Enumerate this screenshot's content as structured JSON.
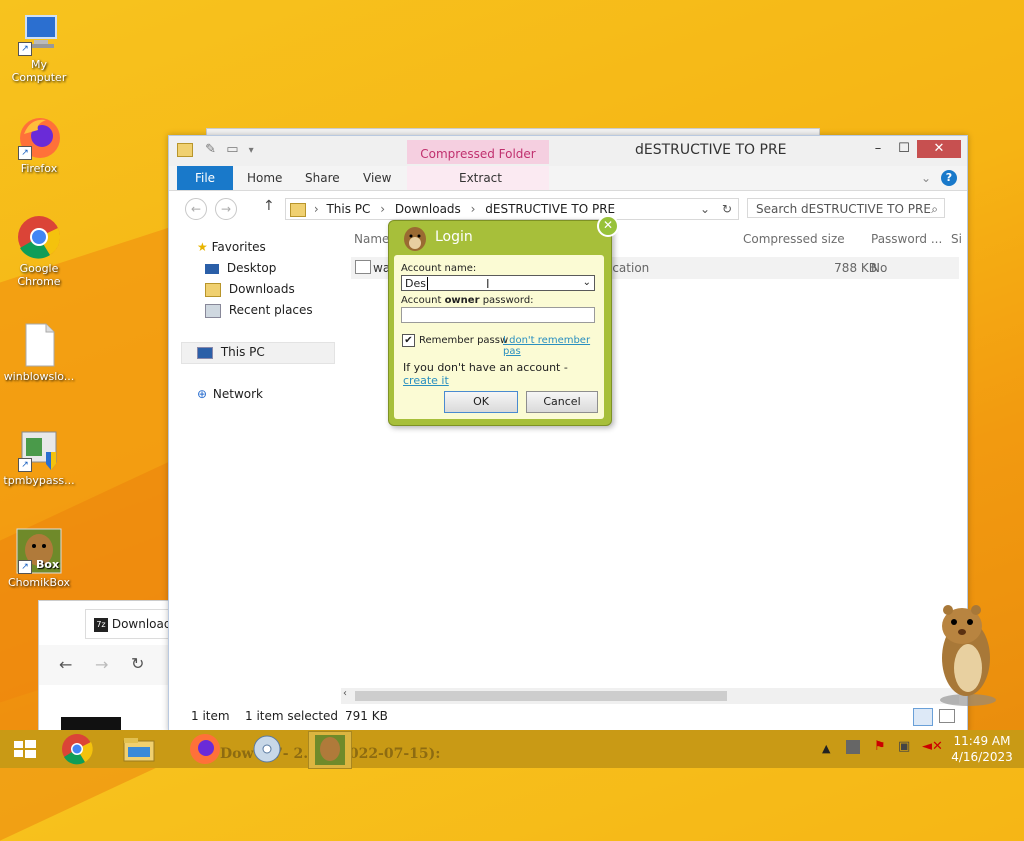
{
  "desktop": {
    "icons": [
      {
        "label": "My Computer",
        "icon": "computer-icon"
      },
      {
        "label": "Firefox",
        "icon": "firefox-icon"
      },
      {
        "label": "Google Chrome",
        "icon": "chrome-icon"
      },
      {
        "label": "winblowslo...",
        "icon": "document-icon"
      },
      {
        "label": "tpmbypass...",
        "icon": "installer-icon"
      },
      {
        "label": "ChomikBox",
        "icon": "chomikbox-icon",
        "badge": "Box"
      }
    ]
  },
  "background_browser": {
    "tab_label": "Download"
  },
  "explorer": {
    "context_tab": "Compressed Folder Tools",
    "title": "dESTRUCTIVE TO PRE",
    "ribbon": {
      "file": "File",
      "home": "Home",
      "share": "Share",
      "view": "View",
      "extract": "Extract"
    },
    "breadcrumb": {
      "this_pc": "This PC",
      "downloads": "Downloads",
      "folder": "dESTRUCTIVE TO PRE"
    },
    "search_placeholder": "Search dESTRUCTIVE TO PRE",
    "nav": {
      "favorites": "Favorites",
      "desktop": "Desktop",
      "downloads": "Downloads",
      "recent_places": "Recent places",
      "this_pc": "This PC",
      "network": "Network"
    },
    "columns": {
      "name": "Name",
      "compressed_size": "Compressed size",
      "password": "Password ...",
      "size": "Si"
    },
    "file": {
      "name": "wa",
      "type": "ication",
      "compressed_size": "788 KB",
      "password": "No"
    },
    "status": {
      "count": "1 item",
      "selected": "1 item selected",
      "size": "791 KB"
    }
  },
  "login": {
    "title": "Login",
    "account_name_label": "Account name:",
    "account_name_value": "Des",
    "password_label_prefix": "Account ",
    "password_label_bold": "owner",
    "password_label_suffix": " password:",
    "password_value": "",
    "remember_label": "Remember passw",
    "remember_checked": true,
    "forgot_link": "I don't remember pas",
    "no_account_text": "If you don't have an account - ",
    "create_link": "create it",
    "ok": "OK",
    "cancel": "Cancel"
  },
  "taskbar": {
    "faded_text": "Dow    d 7-     2.01 (2022-07-15):",
    "clock_time": "11:49 AM",
    "clock_date": "4/16/2023"
  },
  "colors": {
    "accent": "#1979ca",
    "dialog_green": "#a7bf3a",
    "taskbar": "#c99a15",
    "context_pink": "#c0306e"
  }
}
